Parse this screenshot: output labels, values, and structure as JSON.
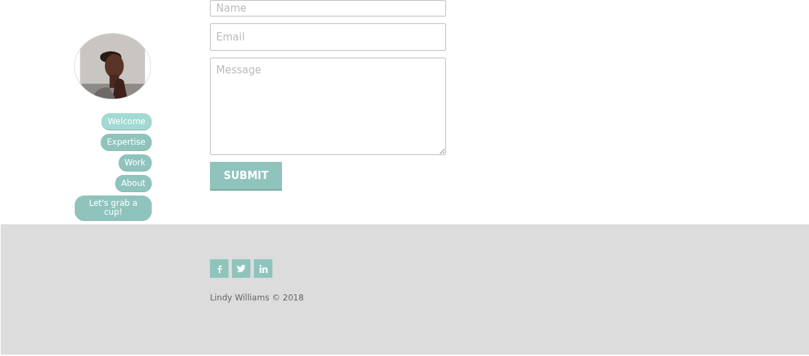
{
  "sidebar": {
    "nav": [
      {
        "label": "Welcome",
        "selected": true
      },
      {
        "label": "Expertise",
        "selected": false
      },
      {
        "label": "Work",
        "selected": false
      },
      {
        "label": "About",
        "selected": false
      },
      {
        "label": "Let's grab a cup!",
        "selected": false
      }
    ]
  },
  "form": {
    "fields": [
      {
        "placeholder": "Name",
        "kind": "input"
      },
      {
        "placeholder": "Email",
        "kind": "input"
      },
      {
        "placeholder": "Message",
        "kind": "textarea"
      }
    ],
    "submit": "SUBMIT"
  },
  "footer": {
    "social": [
      {
        "kind": "facebook"
      },
      {
        "kind": "twitter"
      },
      {
        "kind": "linkedin"
      }
    ],
    "copyright": "Lindy Williams © 2018"
  }
}
